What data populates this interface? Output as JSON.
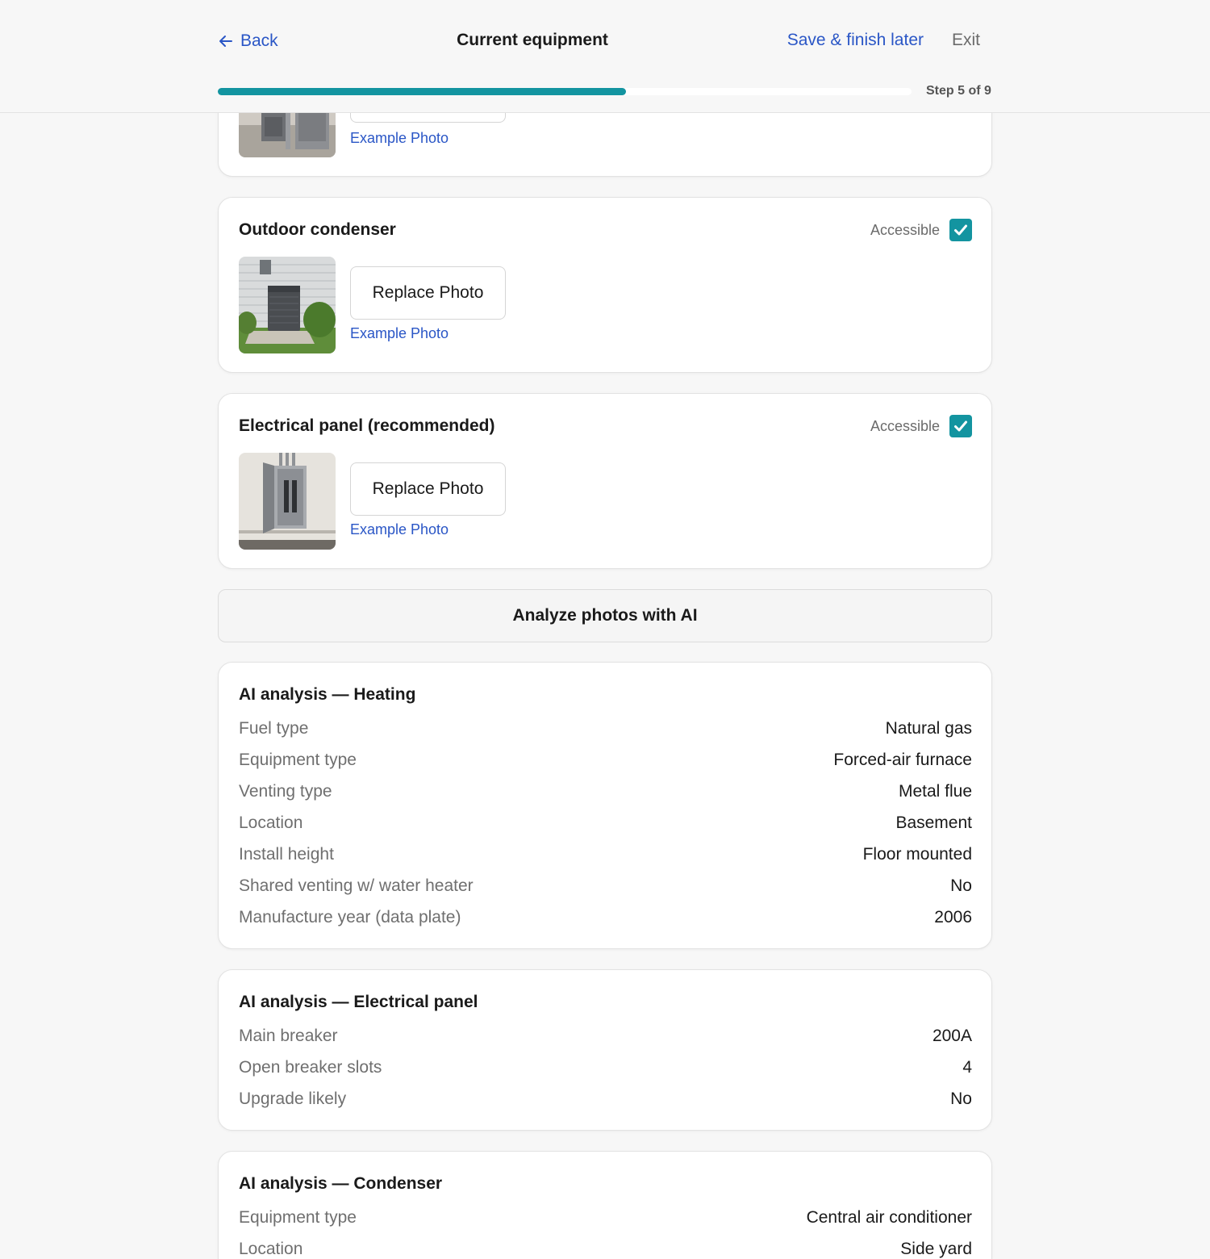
{
  "header": {
    "back_label": "Back",
    "title": "Current equipment",
    "save_label": "Save & finish later",
    "exit_label": "Exit",
    "step_label": "Step 5 of 9",
    "progress": 0.5889,
    "accent_color": "#1394a0",
    "link_color": "#2a56c6"
  },
  "top_card": {
    "example_label": "Example Photo"
  },
  "condenser_card": {
    "title": "Outdoor condenser",
    "accessible_label": "Accessible",
    "accessible_checked": true,
    "replace_label": "Replace Photo",
    "example_label": "Example Photo"
  },
  "panel_card": {
    "title": "Electrical panel (recommended)",
    "accessible_label": "Accessible",
    "accessible_checked": true,
    "replace_label": "Replace Photo",
    "example_label": "Example Photo"
  },
  "analyze_label": "Analyze photos with AI",
  "heating": {
    "title": "AI analysis — Heating",
    "rows": [
      {
        "k": "Fuel type",
        "v": "Natural gas"
      },
      {
        "k": "Equipment type",
        "v": "Forced-air furnace"
      },
      {
        "k": "Venting type",
        "v": "Metal flue"
      },
      {
        "k": "Location",
        "v": "Basement"
      },
      {
        "k": "Install height",
        "v": "Floor mounted"
      },
      {
        "k": "Shared venting w/ water heater",
        "v": "No"
      },
      {
        "k": "Manufacture year (data plate)",
        "v": "2006"
      }
    ]
  },
  "electrical": {
    "title": "AI analysis — Electrical panel",
    "rows": [
      {
        "k": "Main breaker",
        "v": "200A"
      },
      {
        "k": "Open breaker slots",
        "v": "4"
      },
      {
        "k": "Upgrade likely",
        "v": "No"
      }
    ]
  },
  "condenser": {
    "title": "AI analysis — Condenser",
    "rows": [
      {
        "k": "Equipment type",
        "v": "Central air conditioner"
      },
      {
        "k": "Location",
        "v": "Side yard"
      }
    ]
  }
}
